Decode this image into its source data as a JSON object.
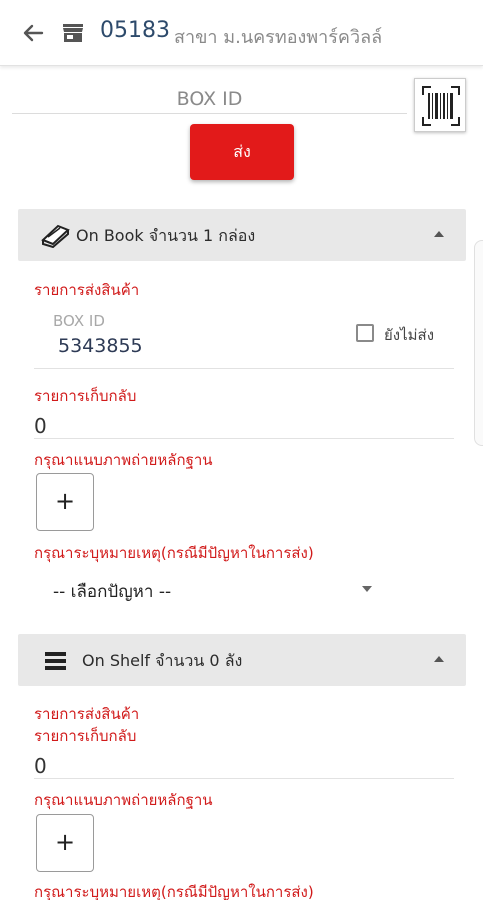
{
  "header": {
    "store_code": "05183",
    "store_name": "สาขา ม.นครทองพาร์ควิลล์"
  },
  "search": {
    "placeholder": "BOX ID",
    "send_label": "ส่ง"
  },
  "on_book": {
    "title": "On Book จำนวน 1 กล่อง",
    "delivery_label": "รายการส่งสินค้า",
    "box_id_label": "BOX ID",
    "box_id_value": "5343855",
    "not_sent_label": "ยังไม่ส่ง",
    "return_label": "รายการเก็บกลับ",
    "return_value": "0",
    "photo_label": "กรุณาแนบภาพถ่ายหลักฐาน",
    "add_label": "+",
    "remark_label": "กรุณาระบุหมายเหตุ(กรณีมีปัญหาในการส่ง)",
    "problem_select": "-- เลือกปัญหา --"
  },
  "on_shelf": {
    "title": "On Shelf จำนวน 0 ลัง",
    "delivery_label": "รายการส่งสินค้า",
    "return_label": "รายการเก็บกลับ",
    "return_value": "0",
    "photo_label": "กรุณาแนบภาพถ่ายหลักฐาน",
    "add_label": "+",
    "remark_label": "กรุณาระบุหมายเหตุ(กรณีมีปัญหาในการส่ง)"
  },
  "icons": {
    "back": "arrow-left-icon",
    "store": "store-icon",
    "barcode": "barcode-scan-icon",
    "book": "book-icon",
    "shelf": "menu-lines-icon"
  },
  "colors": {
    "accent_red": "#e21a1a",
    "label_red": "#d11a1a",
    "store_code": "#2d4a6b",
    "panel_bg": "#e8e8e8"
  }
}
